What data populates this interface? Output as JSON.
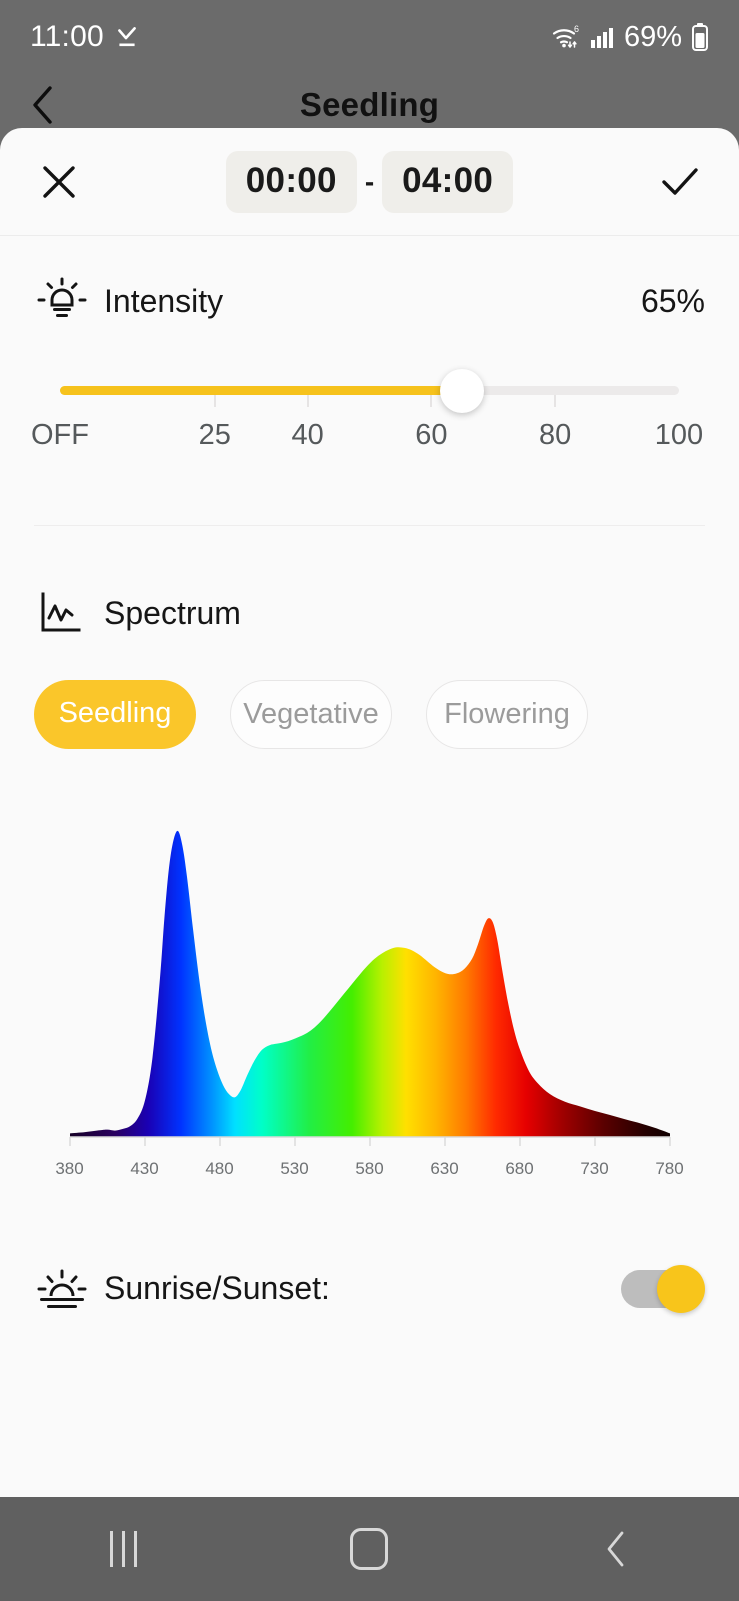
{
  "status_bar": {
    "time": "11:00",
    "download_icon": "download-check-icon",
    "wifi_icon": "wifi-6-icon",
    "signal_icon": "cellular-signal-icon",
    "battery_percent": "69%",
    "battery_icon": "battery-icon"
  },
  "page": {
    "back_icon": "chevron-left-icon",
    "title": "Seedling"
  },
  "sheet": {
    "close_icon": "close-x-icon",
    "confirm_icon": "check-icon",
    "start_time": "00:00",
    "separator": "-",
    "end_time": "04:00"
  },
  "intensity": {
    "icon": "lightbulb-icon",
    "label": "Intensity",
    "value": "65%",
    "slider": {
      "percent": 65,
      "fill_color": "#f6c21c",
      "track_color": "#eceaea",
      "thumb_color": "#ffffff",
      "ticks": [
        "OFF",
        "25",
        "40",
        "60",
        "80",
        "100"
      ],
      "tick_positions": [
        0,
        25,
        40,
        60,
        80,
        100
      ]
    }
  },
  "spectrum": {
    "icon": "chart-line-icon",
    "label": "Spectrum",
    "presets": [
      {
        "label": "Seedling",
        "selected": true
      },
      {
        "label": "Vegetative",
        "selected": false
      },
      {
        "label": "Flowering",
        "selected": false
      }
    ],
    "selected_color": "#fac62a"
  },
  "sunrise": {
    "icon": "sunrise-icon",
    "label": "Sunrise/Sunset:",
    "toggle_on": true,
    "knob_color": "#f8c51b",
    "track_color": "#bdbdbd"
  },
  "nav_bar": {
    "recents_icon": "recents-icon",
    "home_icon": "home-icon",
    "back_icon": "back-chevron-icon"
  },
  "chart_data": {
    "type": "area",
    "title": "",
    "xlabel": "",
    "ylabel": "",
    "xlim": [
      380,
      780
    ],
    "ylim": [
      0,
      1
    ],
    "grid": false,
    "legend": "none",
    "tick_labels": [
      "380",
      "430",
      "480",
      "530",
      "580",
      "630",
      "680",
      "730",
      "780"
    ],
    "ticks": [
      380,
      430,
      480,
      530,
      580,
      630,
      680,
      730,
      780
    ],
    "colormap": "wavelength-visible-spectrum",
    "x": [
      380,
      390,
      400,
      405,
      410,
      415,
      420,
      425,
      430,
      435,
      440,
      443,
      446,
      449,
      452,
      455,
      458,
      462,
      466,
      470,
      474,
      478,
      482,
      486,
      490,
      494,
      498,
      503,
      508,
      513,
      518,
      523,
      528,
      533,
      538,
      543,
      548,
      553,
      558,
      563,
      568,
      573,
      578,
      583,
      588,
      593,
      598,
      603,
      608,
      613,
      618,
      623,
      628,
      633,
      638,
      643,
      648,
      652,
      656,
      659,
      662,
      665,
      668,
      672,
      676,
      680,
      686,
      692,
      700,
      710,
      720,
      730,
      740,
      750,
      760,
      770,
      780
    ],
    "y": [
      0.012,
      0.016,
      0.022,
      0.024,
      0.021,
      0.026,
      0.035,
      0.06,
      0.12,
      0.26,
      0.52,
      0.72,
      0.88,
      0.97,
      1.0,
      0.95,
      0.85,
      0.68,
      0.52,
      0.39,
      0.29,
      0.22,
      0.17,
      0.14,
      0.13,
      0.155,
      0.2,
      0.25,
      0.285,
      0.3,
      0.305,
      0.31,
      0.318,
      0.328,
      0.34,
      0.358,
      0.382,
      0.41,
      0.44,
      0.47,
      0.5,
      0.53,
      0.558,
      0.582,
      0.6,
      0.613,
      0.62,
      0.618,
      0.61,
      0.595,
      0.575,
      0.555,
      0.54,
      0.532,
      0.535,
      0.55,
      0.582,
      0.63,
      0.69,
      0.715,
      0.7,
      0.64,
      0.55,
      0.44,
      0.35,
      0.285,
      0.215,
      0.175,
      0.14,
      0.115,
      0.1,
      0.085,
      0.072,
      0.058,
      0.045,
      0.03,
      0.012
    ]
  }
}
